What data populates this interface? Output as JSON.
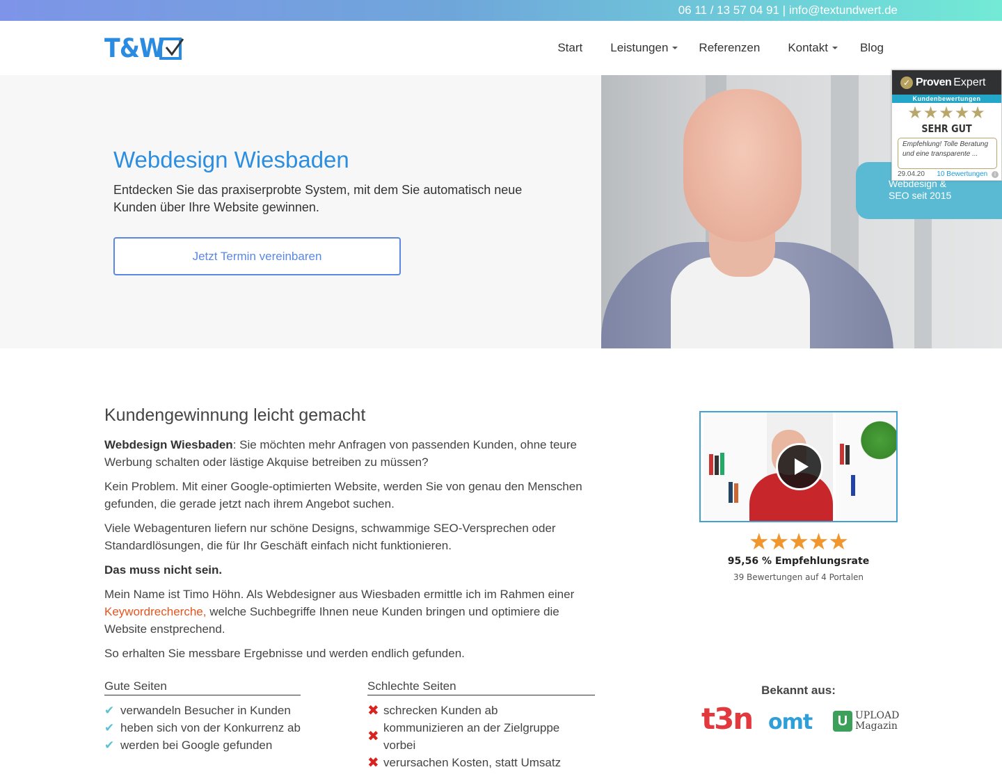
{
  "topbar": {
    "contact": "06 11 / 13 57 04 91 | info@textundwert.de"
  },
  "brand": {
    "logo_text": "T&W",
    "accent_color": "#2b8ee0"
  },
  "nav": {
    "items": [
      {
        "label": "Start",
        "dropdown": false
      },
      {
        "label": "Leistungen",
        "dropdown": true
      },
      {
        "label": "Referenzen",
        "dropdown": false
      },
      {
        "label": "Kontakt",
        "dropdown": true
      },
      {
        "label": "Blog",
        "dropdown": false
      }
    ]
  },
  "hero": {
    "title": "Webdesign Wiesbaden",
    "subtitle": "Entdecken Sie das praxiserprobte System, mit dem Sie automatisch neue Kunden über Ihre Website gewinnen.",
    "cta_label": "Jetzt Termin vereinbaren",
    "ribbon_line1": "Webdesign &",
    "ribbon_line2": "SEO seit 2015"
  },
  "provenexpert": {
    "brand_bold": "Proven",
    "brand_light": "Expert",
    "bar_label": "Kundenbewertungen",
    "stars": "★★★★★",
    "rating_label": "SEHR GUT",
    "quote": "Empfehlung! Tolle Beratung und eine transparente ...",
    "date": "29.04.20",
    "count_label": "10 Bewertungen",
    "star_color": "#b9a66c"
  },
  "main": {
    "heading": "Kundengewinnung leicht gemacht",
    "p1_bold": "Webdesign Wiesbaden",
    "p1_rest": ": Sie möchten mehr Anfragen von passenden Kunden, ohne teure Werbung schalten oder lästige Akquise betreiben zu müssen?",
    "p2": "Kein Problem. Mit einer Google-optimierten Website, werden Sie von genau den Menschen gefunden, die gerade jetzt nach ihrem Angebot suchen.",
    "p3": "Viele Webagenturen liefern nur schöne Designs, schwammige SEO-Versprechen oder Standardlösungen, die für Ihr Geschäft einfach nicht funktionieren.",
    "p4": "Das muss nicht sein.",
    "p5_start": "Mein Name ist Timo Höhn. Als Webdesigner aus Wiesbaden ermittle ich im Rahmen einer ",
    "p5_link": "Keywordrecherche,",
    "p5_end": " welche Suchbegriffe Ihnen neue Kunden bringen und optimiere die Website enstprechend.",
    "p6": "So erhalten Sie messbare Ergebnisse und werden endlich gefunden."
  },
  "good": {
    "heading": "Gute Seiten",
    "items": [
      "verwandeln Besucher in Kunden",
      "heben sich von der Konkurrenz ab",
      "werden bei Google gefunden"
    ]
  },
  "bad": {
    "heading": "Schlechte Seiten",
    "items": [
      "schrecken Kunden ab",
      "kommunizieren an der Zielgruppe vorbei",
      "verursachen Kosten, statt Umsatz"
    ]
  },
  "sidebar": {
    "stars": "★★★★★",
    "rate_text": "95,56 % Empfehlungsrate",
    "rate_sub": "39 Bewertungen auf 4 Portalen",
    "known_label": "Bekannt aus:",
    "press": {
      "t3n": "t3n",
      "omt": "omt",
      "upload_icon": "U",
      "upload_line1": "UPLOAD",
      "upload_line2": "Magazin"
    }
  }
}
